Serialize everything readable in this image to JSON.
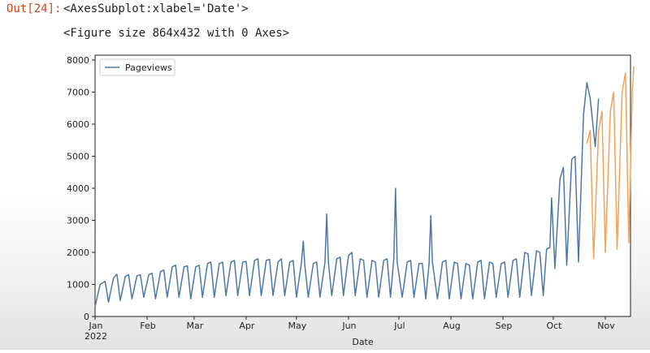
{
  "cell": {
    "prompt": "Out[24]:",
    "repr": "<AxesSubplot:xlabel='Date'>",
    "figure_repr": "<Figure size 864x432 with 0 Axes>"
  },
  "colors": {
    "series_blue": "#4c78a8",
    "series_orange": "#f2a25a",
    "prompt_red": "#d84315",
    "axis": "#222222"
  },
  "chart_data": {
    "type": "line",
    "title": "",
    "xlabel": "Date",
    "ylabel": "",
    "ylim": [
      0,
      8000
    ],
    "yticks": [
      0,
      1000,
      2000,
      3000,
      4000,
      5000,
      6000,
      7000,
      8000
    ],
    "x_range": [
      "2022-01-01",
      "2022-11-16"
    ],
    "xticks": [
      {
        "date": "2022-01-01",
        "label": "Jan",
        "sublabel": "2022"
      },
      {
        "date": "2022-02-01",
        "label": "Feb",
        "sublabel": ""
      },
      {
        "date": "2022-03-01",
        "label": "Mar",
        "sublabel": ""
      },
      {
        "date": "2022-04-01",
        "label": "Apr",
        "sublabel": ""
      },
      {
        "date": "2022-05-01",
        "label": "May",
        "sublabel": ""
      },
      {
        "date": "2022-06-01",
        "label": "Jun",
        "sublabel": ""
      },
      {
        "date": "2022-07-01",
        "label": "Jul",
        "sublabel": ""
      },
      {
        "date": "2022-08-01",
        "label": "Aug",
        "sublabel": ""
      },
      {
        "date": "2022-09-01",
        "label": "Sep",
        "sublabel": ""
      },
      {
        "date": "2022-10-01",
        "label": "Oct",
        "sublabel": ""
      },
      {
        "date": "2022-11-01",
        "label": "Nov",
        "sublabel": ""
      }
    ],
    "legend": {
      "placement": "upper-left",
      "entries": [
        "Pageviews"
      ]
    },
    "grid": false,
    "series": [
      {
        "name": "Pageviews",
        "color": "#4c78a8",
        "points": [
          [
            "2022-01-01",
            300
          ],
          [
            "2022-01-04",
            1000
          ],
          [
            "2022-01-07",
            1100
          ],
          [
            "2022-01-09",
            450
          ],
          [
            "2022-01-12",
            1200
          ],
          [
            "2022-01-14",
            1320
          ],
          [
            "2022-01-16",
            500
          ],
          [
            "2022-01-19",
            1250
          ],
          [
            "2022-01-21",
            1300
          ],
          [
            "2022-01-23",
            550
          ],
          [
            "2022-01-26",
            1270
          ],
          [
            "2022-01-28",
            1300
          ],
          [
            "2022-01-30",
            600
          ],
          [
            "2022-02-02",
            1300
          ],
          [
            "2022-02-04",
            1350
          ],
          [
            "2022-02-06",
            550
          ],
          [
            "2022-02-09",
            1400
          ],
          [
            "2022-02-11",
            1450
          ],
          [
            "2022-02-13",
            600
          ],
          [
            "2022-02-16",
            1550
          ],
          [
            "2022-02-18",
            1600
          ],
          [
            "2022-02-20",
            600
          ],
          [
            "2022-02-23",
            1550
          ],
          [
            "2022-02-25",
            1580
          ],
          [
            "2022-02-27",
            550
          ],
          [
            "2022-03-02",
            1550
          ],
          [
            "2022-03-04",
            1600
          ],
          [
            "2022-03-06",
            600
          ],
          [
            "2022-03-09",
            1650
          ],
          [
            "2022-03-11",
            1700
          ],
          [
            "2022-03-13",
            600
          ],
          [
            "2022-03-16",
            1650
          ],
          [
            "2022-03-18",
            1700
          ],
          [
            "2022-03-20",
            650
          ],
          [
            "2022-03-23",
            1700
          ],
          [
            "2022-03-25",
            1750
          ],
          [
            "2022-03-27",
            650
          ],
          [
            "2022-03-30",
            1700
          ],
          [
            "2022-04-01",
            1720
          ],
          [
            "2022-04-03",
            650
          ],
          [
            "2022-04-06",
            1750
          ],
          [
            "2022-04-08",
            1800
          ],
          [
            "2022-04-10",
            650
          ],
          [
            "2022-04-13",
            1750
          ],
          [
            "2022-04-15",
            1780
          ],
          [
            "2022-04-17",
            650
          ],
          [
            "2022-04-20",
            1700
          ],
          [
            "2022-04-22",
            1800
          ],
          [
            "2022-04-24",
            650
          ],
          [
            "2022-04-27",
            1700
          ],
          [
            "2022-04-29",
            1750
          ],
          [
            "2022-05-01",
            600
          ],
          [
            "2022-05-04",
            1700
          ],
          [
            "2022-05-05",
            2350
          ],
          [
            "2022-05-06",
            1600
          ],
          [
            "2022-05-08",
            600
          ],
          [
            "2022-05-11",
            1650
          ],
          [
            "2022-05-13",
            1700
          ],
          [
            "2022-05-15",
            600
          ],
          [
            "2022-05-18",
            1700
          ],
          [
            "2022-05-19",
            3200
          ],
          [
            "2022-05-20",
            1700
          ],
          [
            "2022-05-22",
            650
          ],
          [
            "2022-05-25",
            1800
          ],
          [
            "2022-05-27",
            1850
          ],
          [
            "2022-05-29",
            650
          ],
          [
            "2022-06-01",
            1900
          ],
          [
            "2022-06-03",
            2000
          ],
          [
            "2022-06-05",
            650
          ],
          [
            "2022-06-08",
            1800
          ],
          [
            "2022-06-10",
            1750
          ],
          [
            "2022-06-12",
            600
          ],
          [
            "2022-06-15",
            1750
          ],
          [
            "2022-06-17",
            1700
          ],
          [
            "2022-06-19",
            600
          ],
          [
            "2022-06-22",
            1750
          ],
          [
            "2022-06-24",
            1800
          ],
          [
            "2022-06-26",
            600
          ],
          [
            "2022-06-28",
            1800
          ],
          [
            "2022-06-29",
            4000
          ],
          [
            "2022-06-30",
            1700
          ],
          [
            "2022-07-03",
            600
          ],
          [
            "2022-07-06",
            1700
          ],
          [
            "2022-07-08",
            1750
          ],
          [
            "2022-07-10",
            600
          ],
          [
            "2022-07-13",
            1650
          ],
          [
            "2022-07-15",
            1650
          ],
          [
            "2022-07-17",
            550
          ],
          [
            "2022-07-19",
            1650
          ],
          [
            "2022-07-20",
            3150
          ],
          [
            "2022-07-21",
            1700
          ],
          [
            "2022-07-24",
            550
          ],
          [
            "2022-07-27",
            1700
          ],
          [
            "2022-07-29",
            1750
          ],
          [
            "2022-07-31",
            550
          ],
          [
            "2022-08-03",
            1700
          ],
          [
            "2022-08-05",
            1650
          ],
          [
            "2022-08-07",
            550
          ],
          [
            "2022-08-10",
            1650
          ],
          [
            "2022-08-12",
            1600
          ],
          [
            "2022-08-14",
            550
          ],
          [
            "2022-08-17",
            1700
          ],
          [
            "2022-08-19",
            1750
          ],
          [
            "2022-08-21",
            550
          ],
          [
            "2022-08-24",
            1700
          ],
          [
            "2022-08-26",
            1650
          ],
          [
            "2022-08-28",
            600
          ],
          [
            "2022-08-31",
            1650
          ],
          [
            "2022-09-02",
            1700
          ],
          [
            "2022-09-04",
            600
          ],
          [
            "2022-09-07",
            1750
          ],
          [
            "2022-09-09",
            1800
          ],
          [
            "2022-09-11",
            600
          ],
          [
            "2022-09-14",
            2000
          ],
          [
            "2022-09-16",
            1950
          ],
          [
            "2022-09-18",
            650
          ],
          [
            "2022-09-21",
            2050
          ],
          [
            "2022-09-23",
            2000
          ],
          [
            "2022-09-25",
            650
          ],
          [
            "2022-09-27",
            2100
          ],
          [
            "2022-09-29",
            2150
          ],
          [
            "2022-09-30",
            3700
          ],
          [
            "2022-10-02",
            1500
          ],
          [
            "2022-10-05",
            4300
          ],
          [
            "2022-10-07",
            4650
          ],
          [
            "2022-10-09",
            1600
          ],
          [
            "2022-10-12",
            4900
          ],
          [
            "2022-10-14",
            5000
          ],
          [
            "2022-10-16",
            1700
          ],
          [
            "2022-10-19",
            6300
          ],
          [
            "2022-10-21",
            7300
          ],
          [
            "2022-10-23",
            6800
          ],
          [
            "2022-10-26",
            5300
          ],
          [
            "2022-10-28",
            6800
          ]
        ]
      },
      {
        "name": "",
        "color": "#f2a25a",
        "points": [
          [
            "2022-10-21",
            5400
          ],
          [
            "2022-10-23",
            5800
          ],
          [
            "2022-10-25",
            1800
          ],
          [
            "2022-10-28",
            5800
          ],
          [
            "2022-10-30",
            6400
          ],
          [
            "2022-11-01",
            2000
          ],
          [
            "2022-11-04",
            6400
          ],
          [
            "2022-11-06",
            7000
          ],
          [
            "2022-11-08",
            2100
          ],
          [
            "2022-11-11",
            7000
          ],
          [
            "2022-11-13",
            7600
          ],
          [
            "2022-11-15",
            2300
          ],
          [
            "2022-11-17",
            7000
          ],
          [
            "2022-11-18",
            7800
          ]
        ]
      }
    ]
  }
}
